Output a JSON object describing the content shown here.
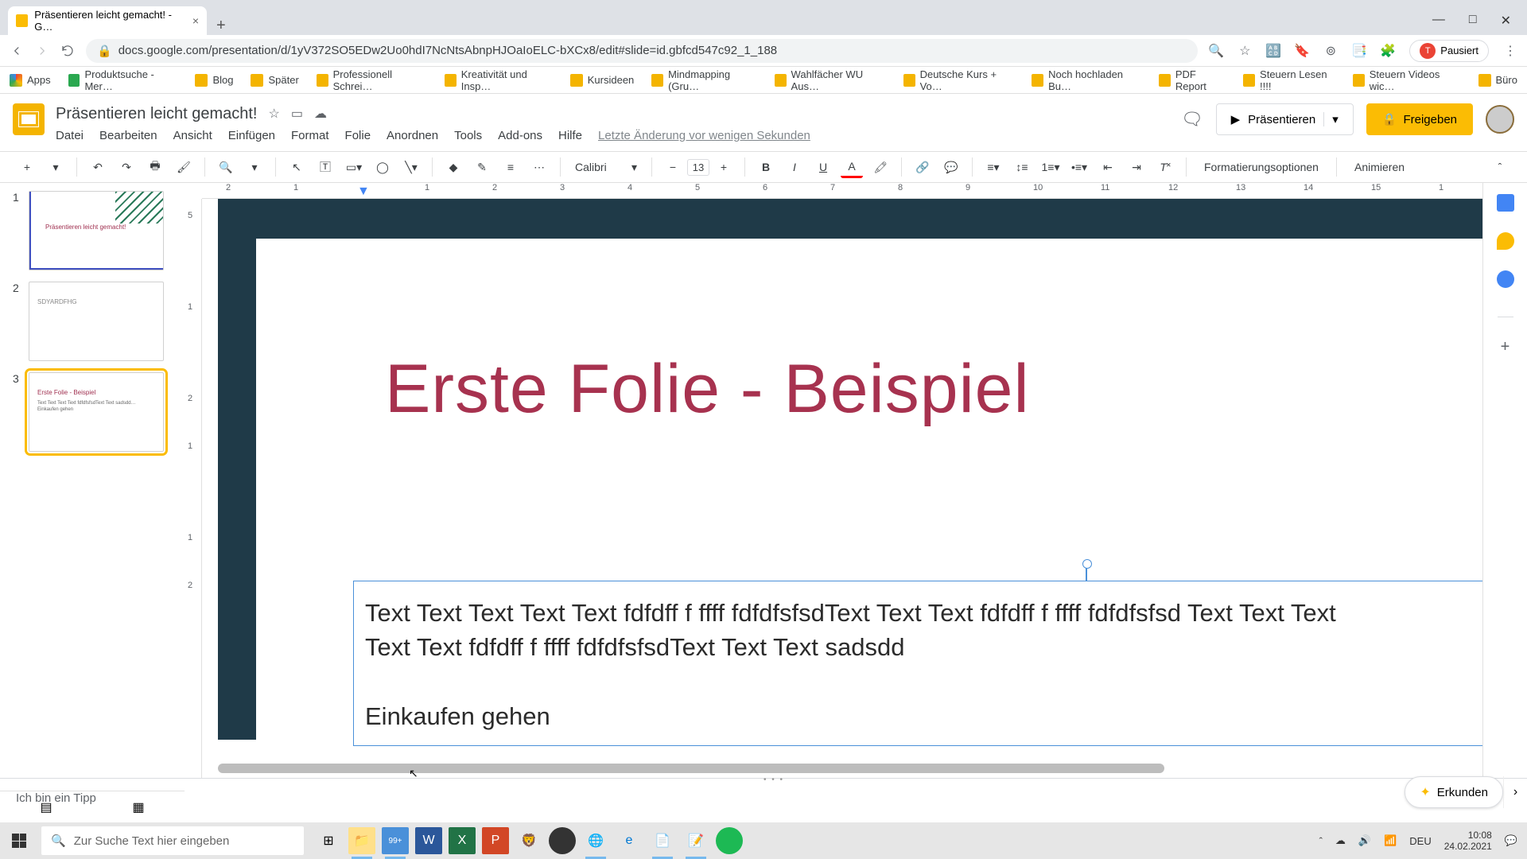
{
  "browser": {
    "tab_title": "Präsentieren leicht gemacht! - G…",
    "url": "docs.google.com/presentation/d/1yV372SO5EDw2Uo0hdI7NcNtsAbnpHJOaIoELC-bXCx8/edit#slide=id.gbfcd547c92_1_188",
    "pause_label": "Pausiert"
  },
  "bookmarks": [
    "Apps",
    "Produktsuche - Mer…",
    "Blog",
    "Später",
    "Professionell Schrei…",
    "Kreativität und Insp…",
    "Kursideen",
    "Mindmapping  (Gru…",
    "Wahlfächer WU Aus…",
    "Deutsche Kurs + Vo…",
    "Noch hochladen Bu…",
    "PDF Report",
    "Steuern Lesen !!!!",
    "Steuern Videos wic…",
    "Büro"
  ],
  "doc": {
    "title": "Präsentieren leicht gemacht!",
    "last_change": "Letzte Änderung vor wenigen Sekunden"
  },
  "menu": [
    "Datei",
    "Bearbeiten",
    "Ansicht",
    "Einfügen",
    "Format",
    "Folie",
    "Anordnen",
    "Tools",
    "Add-ons",
    "Hilfe"
  ],
  "header_buttons": {
    "present": "Präsentieren",
    "share": "Freigeben"
  },
  "toolbar": {
    "font": "Calibri",
    "font_size": "13",
    "format_options": "Formatierungsoptionen",
    "animate": "Animieren"
  },
  "ruler_h": [
    "2",
    "1",
    "",
    "1",
    "2",
    "3",
    "4",
    "5",
    "6",
    "7",
    "8",
    "9",
    "10",
    "11",
    "12",
    "13",
    "14",
    "15",
    "1"
  ],
  "ruler_v": [
    "5",
    "",
    "1",
    "",
    "2",
    "1",
    "",
    "1",
    "2"
  ],
  "slides": [
    {
      "num": "1",
      "thumb_title": "Präsentieren leicht gemacht!"
    },
    {
      "num": "2",
      "thumb_title": "SDYARDFHG"
    },
    {
      "num": "3",
      "thumb_title": "Erste Folie - Beispiel",
      "thumb_body": "Text Text Text Text fdfdfsfsdText Text sadsdd… Einkaufen gehen"
    }
  ],
  "slide_content": {
    "heading": "Erste Folie - Beispiel",
    "body_line1_parts": [
      "Text Text Text Text Text ",
      "fdfdff",
      " f ",
      "ffff",
      " ",
      "fdfdfsfsdText",
      " Text Text ",
      "fdfdff",
      " f ",
      "ffff",
      " ",
      "fdfdfsfsd",
      " Text Text Text "
    ],
    "body_line2_parts": [
      "Text Text ",
      "fdfdff",
      " f ",
      "ffff",
      " ",
      "fdfdfsfsdText",
      " Text Text ",
      "sadsdd"
    ],
    "body_line3": "Einkaufen gehen"
  },
  "notes": "Ich bin ein Tipp",
  "explore": "Erkunden",
  "taskbar": {
    "search_placeholder": "Zur Suche Text hier eingeben",
    "lang": "DEU",
    "time": "10:08",
    "date": "24.02.2021"
  }
}
